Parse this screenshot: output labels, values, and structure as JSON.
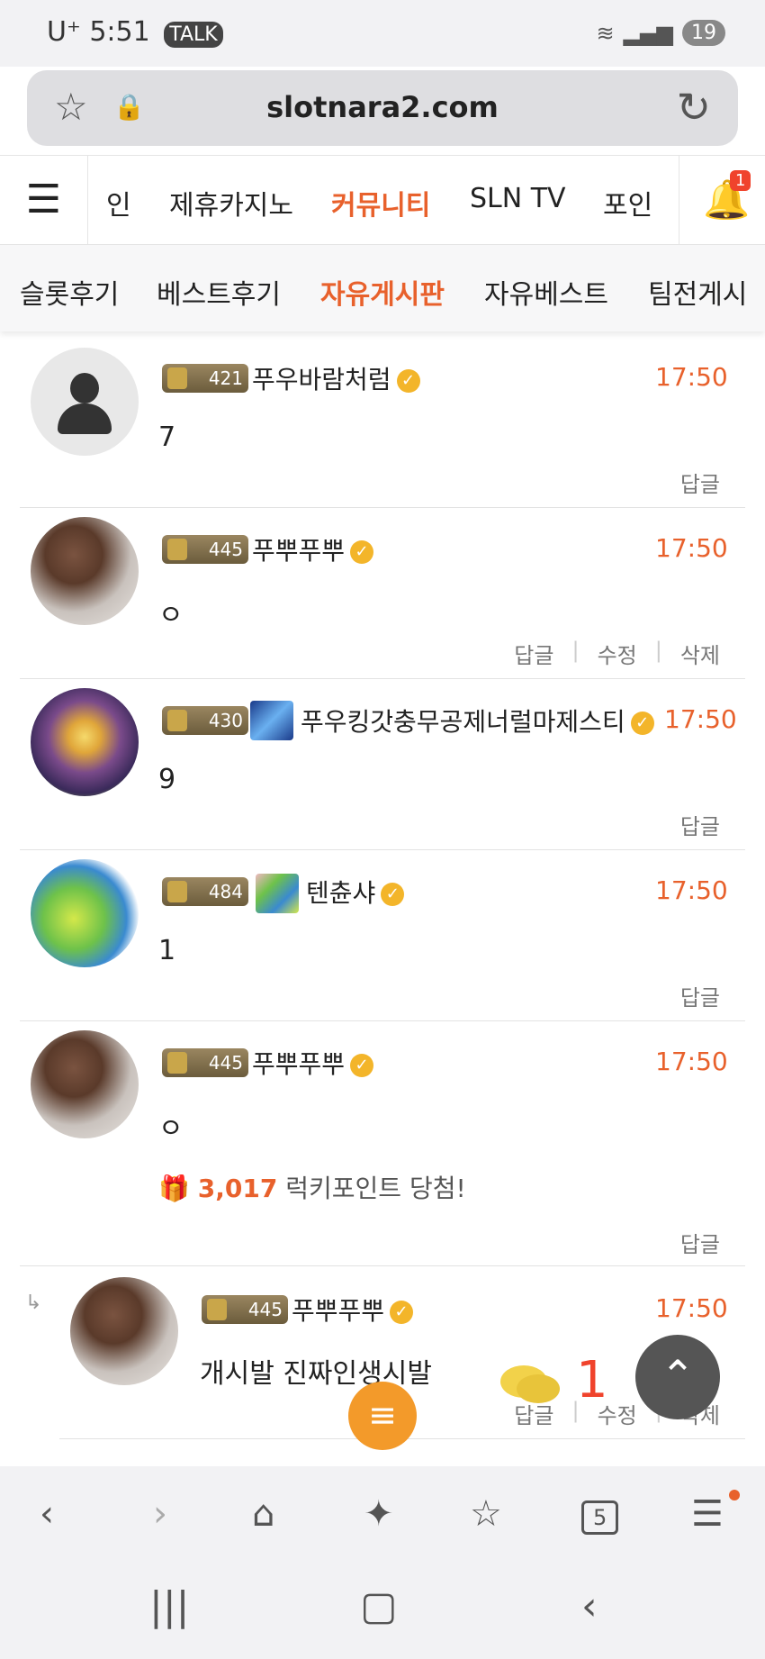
{
  "status": {
    "carrier": "U⁺",
    "time": "5:51",
    "battery": "19"
  },
  "browser": {
    "url": "slotnara2.com",
    "tabs_count": "5"
  },
  "nav_main": {
    "items": [
      "인",
      "제휴카지노",
      "커뮤니티",
      "SLN TV",
      "포인"
    ],
    "active": "커뮤니티",
    "bell_badge": "1"
  },
  "nav_sub": {
    "items": [
      "슬롯후기",
      "베스트후기",
      "자유게시판",
      "자유베스트",
      "팀전게시"
    ],
    "active": "자유게시판"
  },
  "comments": [
    {
      "level": "421",
      "name": "푸우바람처럼",
      "time": "17:50",
      "text": "7",
      "actions": [
        "답글"
      ]
    },
    {
      "level": "445",
      "name": "푸뿌푸뿌",
      "time": "17:50",
      "text": "ㅇ",
      "actions": [
        "답글",
        "수정",
        "삭제"
      ]
    },
    {
      "level": "430",
      "name": "푸우킹갓충무공제너럴마제스티",
      "time": "17:50",
      "text": "9",
      "actions": [
        "답글"
      ]
    },
    {
      "level": "484",
      "name": "텐츈샤",
      "time": "17:50",
      "text": "1",
      "actions": [
        "답글"
      ]
    },
    {
      "level": "445",
      "name": "푸뿌푸뿌",
      "time": "17:50",
      "text": "ㅇ",
      "lucky_points": "3,017",
      "lucky_text": "럭키포인트 당첨!",
      "actions": [
        "답글"
      ]
    },
    {
      "level": "445",
      "name": "푸뿌푸뿌",
      "time": "17:50",
      "text": "개시발 진짜인생시발",
      "actions": [
        "답글",
        "수정",
        "삭제"
      ]
    }
  ],
  "floating": {
    "chat_count": "1"
  },
  "colors": {
    "accent": "#e8612c",
    "fab": "#f39a2a",
    "badge": "#f0432c"
  }
}
